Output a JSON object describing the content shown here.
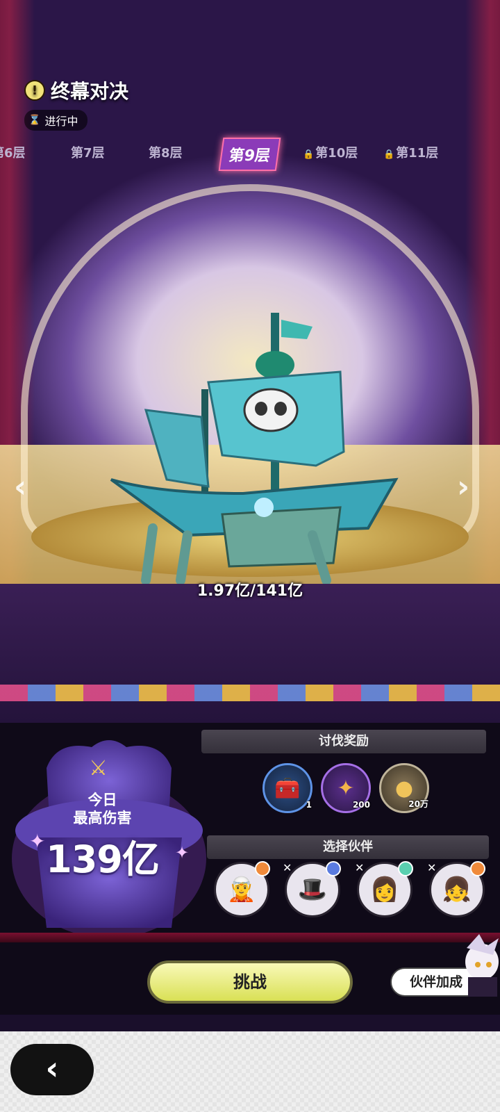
{
  "event": {
    "title": "终幕对决",
    "status": "进行中"
  },
  "floors": {
    "tabs": [
      {
        "label": "第6层",
        "locked": false
      },
      {
        "label": "第7层",
        "locked": false
      },
      {
        "label": "第8层",
        "locked": false
      },
      {
        "label": "第9层",
        "locked": false,
        "active": true
      },
      {
        "label": "第10层",
        "locked": true
      },
      {
        "label": "第11层",
        "locked": true
      }
    ]
  },
  "boss": {
    "hp_text": "1.97亿/141亿"
  },
  "damage": {
    "label_line1": "今日",
    "label_line2": "最高伤害",
    "value": "139亿"
  },
  "rewards": {
    "title": "讨伐奖励",
    "items": [
      {
        "icon": "chest-icon",
        "count": "1"
      },
      {
        "icon": "crystal-icon",
        "count": "200"
      },
      {
        "icon": "coin-icon",
        "count": "20万"
      }
    ]
  },
  "partners": {
    "title": "选择伙伴",
    "slots": [
      {
        "icon": "partner-avatar-1",
        "removable": false,
        "element_color": "#f08a3a"
      },
      {
        "icon": "partner-avatar-2",
        "removable": true,
        "element_color": "#5a7be0"
      },
      {
        "icon": "partner-avatar-3",
        "removable": true,
        "element_color": "#5ad0b0"
      },
      {
        "icon": "partner-avatar-4",
        "removable": true,
        "element_color": "#f08a3a"
      }
    ]
  },
  "actions": {
    "challenge_label": "挑战",
    "bonus_label": "伙伴加成"
  },
  "colors": {
    "accent": "#e8ec7a",
    "panel": "#0f0a18",
    "active_tab": "#8b3bb8"
  }
}
